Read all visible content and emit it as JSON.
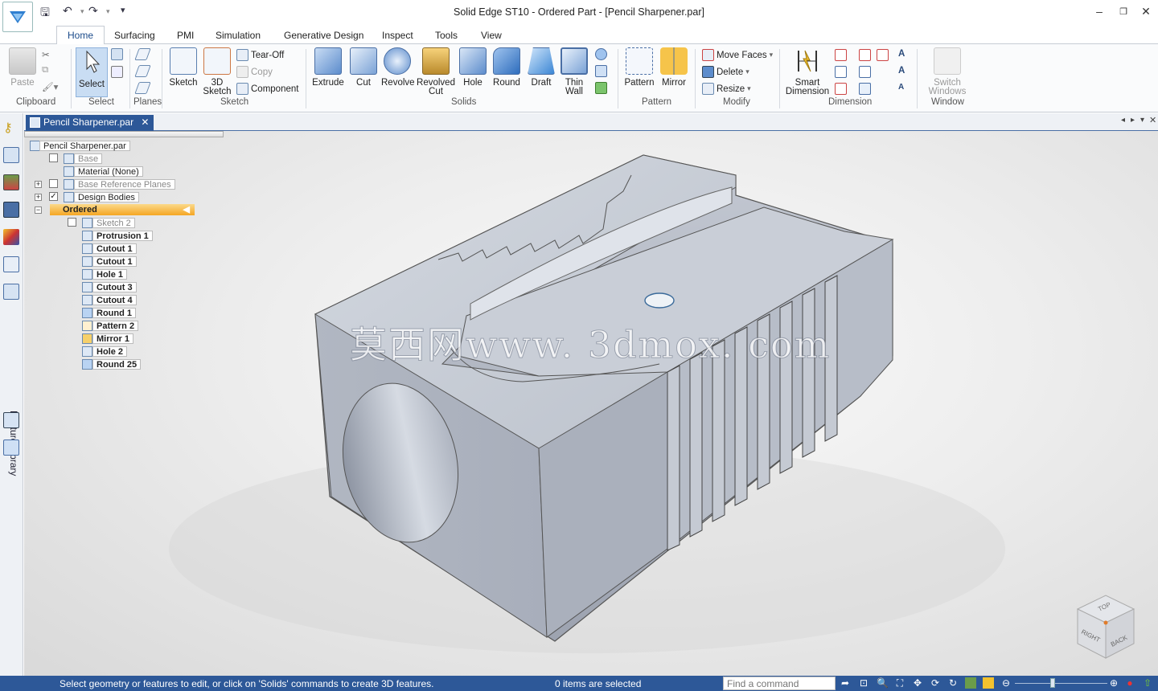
{
  "window": {
    "title": "Solid Edge ST10 - Ordered Part - [Pencil Sharpener.par]"
  },
  "tabs": [
    "Home",
    "Surfacing",
    "PMI",
    "Simulation",
    "Generative Design",
    "Inspect",
    "Tools",
    "View"
  ],
  "active_tab": "Home",
  "ribbon": {
    "clipboard": {
      "label": "Clipboard",
      "paste": "Paste"
    },
    "select": {
      "label": "Select",
      "select": "Select"
    },
    "planes": {
      "label": "Planes"
    },
    "sketch": {
      "label": "Sketch",
      "sketch": "Sketch",
      "sketch3d_1": "3D",
      "sketch3d_2": "Sketch",
      "tear_off": "Tear-Off",
      "copy": "Copy",
      "component": "Component"
    },
    "solids": {
      "label": "Solids",
      "extrude": "Extrude",
      "cut": "Cut",
      "revolve": "Revolve",
      "revolved_cut_1": "Revolved",
      "revolved_cut_2": "Cut",
      "hole": "Hole",
      "round": "Round",
      "draft": "Draft",
      "thin_wall_1": "Thin",
      "thin_wall_2": "Wall"
    },
    "pattern": {
      "label": "Pattern",
      "pattern": "Pattern",
      "mirror": "Mirror"
    },
    "modify": {
      "label": "Modify",
      "move_faces": "Move Faces",
      "delete": "Delete",
      "resize": "Resize"
    },
    "dimension": {
      "label": "Dimension",
      "smart_1": "Smart",
      "smart_2": "Dimension"
    },
    "window": {
      "label": "Window",
      "switch_1": "Switch",
      "switch_2": "Windows"
    }
  },
  "side_panel": {
    "feature_library": "Feature Library"
  },
  "document": {
    "tab_name": "Pencil Sharpener.par"
  },
  "tree": {
    "root": "Pencil Sharpener.par",
    "base": "Base",
    "material": "Material (None)",
    "base_planes": "Base Reference Planes",
    "design_bodies": "Design Bodies",
    "ordered": "Ordered",
    "features": [
      "Sketch 2",
      "Protrusion 1",
      "Cutout 1",
      "Cutout 1",
      "Hole 1",
      "Cutout 3",
      "Cutout 4",
      "Round 1",
      "Pattern 2",
      "Mirror 1",
      "Hole 2",
      "Round 25"
    ]
  },
  "watermark": "莫西网www. 3dmox. com",
  "navcube": {
    "top": "TOP",
    "right": "RIGHT",
    "back": "BACK"
  },
  "status": {
    "message": "Select geometry or features to edit, or click on 'Solids' commands to create 3D features.",
    "selection": "0 items are selected",
    "command_placeholder": "Find a command"
  },
  "colors": {
    "accent": "#2d5898",
    "ordered_highlight": "#f5a623",
    "part_face": "#b8bfcc"
  }
}
